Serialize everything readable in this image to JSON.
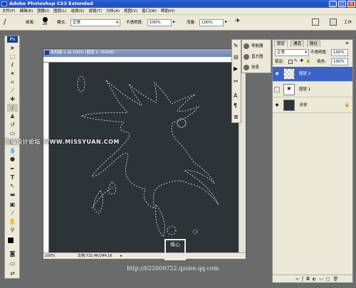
{
  "app": {
    "title": "Adobe Photoshop CS3 Extended",
    "logo_text": "Ps"
  },
  "window_buttons": [
    "_",
    "□",
    "X"
  ],
  "menu": [
    "文件(F)",
    "编辑(E)",
    "图像(I)",
    "图层(L)",
    "选择(S)",
    "滤镜(T)",
    "分析(A)",
    "视图(V)",
    "窗口(W)",
    "帮助(H)"
  ],
  "options": {
    "brush_label": "画笔:",
    "brush_size": "28",
    "mode_label": "模式:",
    "mode_value": "正常",
    "opacity_label": "不透明度:",
    "opacity_value": "100%",
    "flow_label": "流量:",
    "flow_value": "100%",
    "workspace_label": "工作"
  },
  "document": {
    "title": "未标题-1 @ 100% (图层 2, RGB/8)",
    "zoom": "100%",
    "doc_size": "文档:732.4K/244.1K"
  },
  "nav_panel": {
    "items": [
      "导航器",
      "直方图",
      "信息"
    ]
  },
  "layers_panel": {
    "tabs": [
      "图层",
      "通道",
      "路径"
    ],
    "blend_mode": "正常",
    "opacity_label": "不透明度:",
    "opacity_value": "100%",
    "lock_label": "锁定:",
    "fill_label": "填充:",
    "fill_value": "100%",
    "layers": [
      {
        "name": "图层 2",
        "selected": true,
        "visible": true
      },
      {
        "name": "图层 1",
        "selected": false,
        "visible": false
      },
      {
        "name": "背景",
        "selected": false,
        "visible": true,
        "locked": true
      }
    ]
  },
  "watermarks": {
    "site": "思缘设计论坛 WWW.MISSYUAN.COM",
    "url": "http://622009722.qzone.qq.com",
    "stamp": "缘心"
  },
  "colors": {
    "canvas": "#2d3438",
    "workspace": "#6b6b6b",
    "selection": "#3a62c9"
  }
}
